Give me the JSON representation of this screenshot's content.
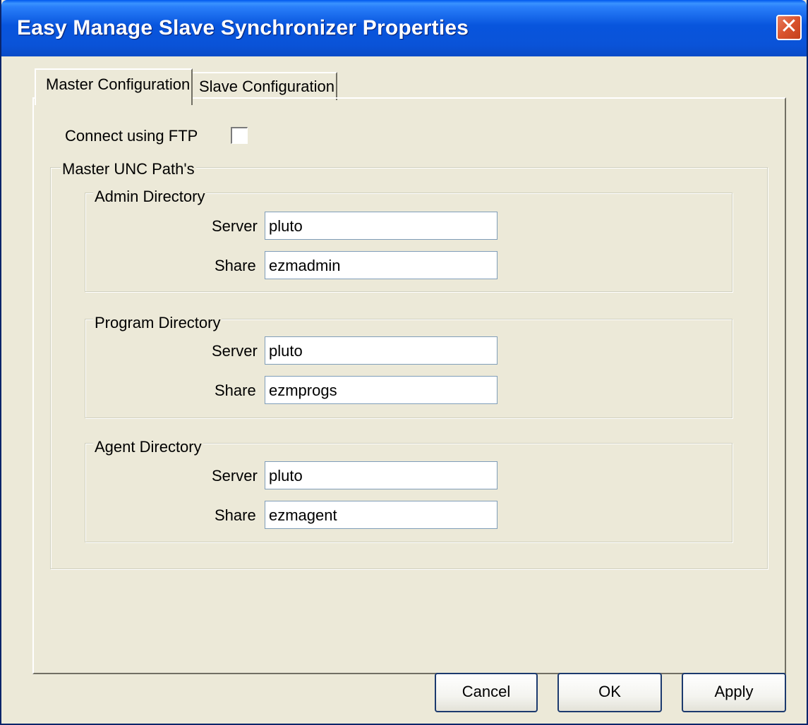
{
  "window": {
    "title": "Easy Manage Slave Synchronizer Properties",
    "close_glyph": "✕"
  },
  "tabs": [
    {
      "label": "Master Configuration",
      "active": true
    },
    {
      "label": "Slave Configuration",
      "active": false
    }
  ],
  "ftp": {
    "label": "Connect using FTP",
    "checked": false
  },
  "master_group": {
    "caption": "Master UNC Path's"
  },
  "groups": [
    {
      "caption": "Admin Directory",
      "server_label": "Server",
      "server_value": "pluto",
      "share_label": "Share",
      "share_value": "ezmadmin"
    },
    {
      "caption": "Program Directory",
      "server_label": "Server",
      "server_value": "pluto",
      "share_label": "Share",
      "share_value": "ezmprogs"
    },
    {
      "caption": "Agent Directory",
      "server_label": "Server",
      "server_value": "pluto",
      "share_label": "Share",
      "share_value": "ezmagent"
    }
  ],
  "buttons": {
    "cancel": "Cancel",
    "ok": "OK",
    "apply": "Apply"
  },
  "colors": {
    "title_bar": "#0a53d8",
    "dialog_bg": "#ece9d8",
    "close_button": "#d9532d",
    "input_border": "#7f9db9"
  }
}
